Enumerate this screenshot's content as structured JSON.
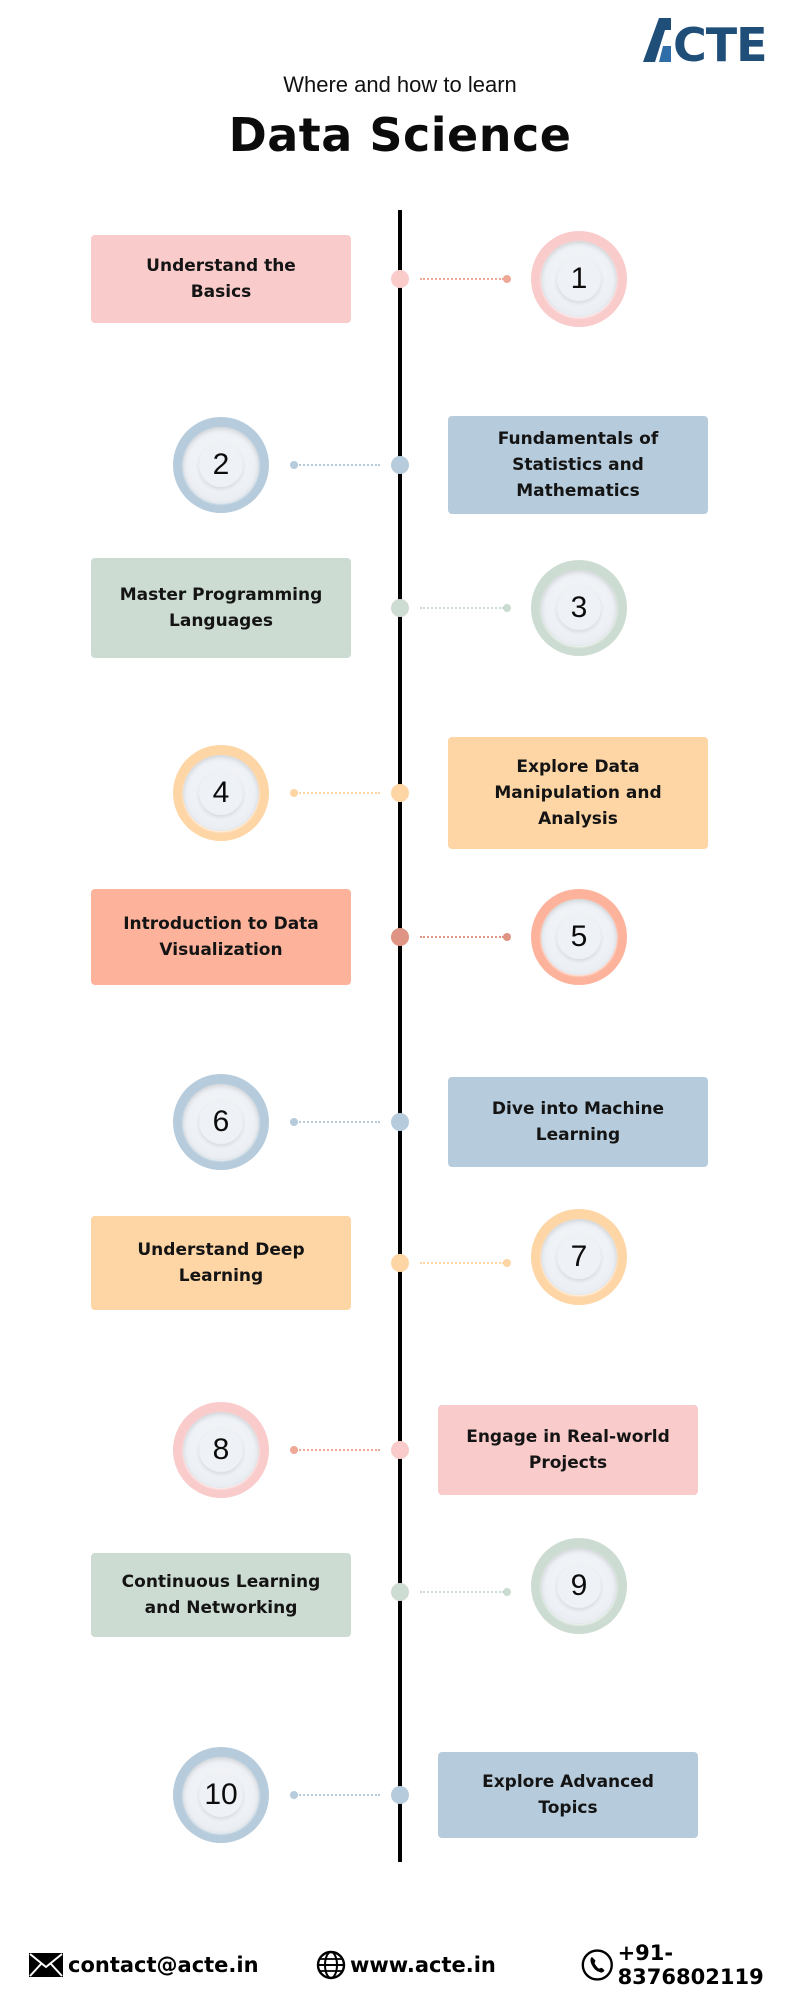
{
  "brand": {
    "logo_text": "ACTE",
    "logo_color": "#1f4e79",
    "logo_accent": "#2f6ea8"
  },
  "header": {
    "subtitle": "Where and how to learn",
    "title": "Data Science"
  },
  "colors": {
    "pink": "#f9cbcb",
    "blue": "#b6cbdb",
    "green": "#cddcd2",
    "peach": "#fed5a5",
    "salmon": "#fdb39b",
    "pink_dot": "#f0a896",
    "blue_dot": "#b6cbdb",
    "green_dot": "#cddcd2",
    "peach_dot": "#fed5a5",
    "salmon_dot": "#e09483"
  },
  "steps": [
    {
      "number": "1",
      "label": "Understand the Basics",
      "side": "left",
      "color": "pink"
    },
    {
      "number": "2",
      "label": "Fundamentals of Statistics and Mathematics",
      "side": "right",
      "color": "blue"
    },
    {
      "number": "3",
      "label": "Master Programming Languages",
      "side": "left",
      "color": "green"
    },
    {
      "number": "4",
      "label": "Explore Data Manipulation and Analysis",
      "side": "right",
      "color": "peach"
    },
    {
      "number": "5",
      "label": "Introduction to Data Visualization",
      "side": "left",
      "color": "salmon"
    },
    {
      "number": "6",
      "label": "Dive into Machine Learning",
      "side": "right",
      "color": "blue"
    },
    {
      "number": "7",
      "label": "Understand Deep Learning",
      "side": "left",
      "color": "peach"
    },
    {
      "number": "8",
      "label": "Engage in Real-world Projects",
      "side": "right",
      "color": "pink"
    },
    {
      "number": "9",
      "label": "Continuous Learning and Networking",
      "side": "left",
      "color": "green"
    },
    {
      "number": "10",
      "label": "Explore Advanced Topics",
      "side": "right",
      "color": "blue"
    }
  ],
  "footer": {
    "email": {
      "icon": "envelope-icon",
      "text": "contact@acte.in"
    },
    "website": {
      "icon": "globe-icon",
      "text": "www.acte.in"
    },
    "phone": {
      "icon": "phone-icon",
      "text": "+91-8376802119"
    }
  }
}
